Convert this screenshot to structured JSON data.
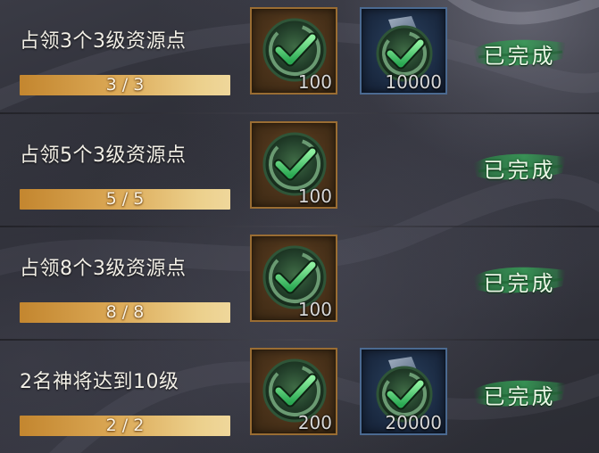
{
  "quests": [
    {
      "title": "占领3个3级资源点",
      "progress_text": "3 / 3",
      "progress_fraction": 1.0,
      "rewards": [
        {
          "type": "bronze",
          "icon": "check-emblem-icon",
          "quantity": "100"
        },
        {
          "type": "blue",
          "icon": "check-emblem-icon",
          "quantity": "10000"
        }
      ],
      "status": "已完成"
    },
    {
      "title": "占领5个3级资源点",
      "progress_text": "5 / 5",
      "progress_fraction": 1.0,
      "rewards": [
        {
          "type": "bronze",
          "icon": "check-emblem-icon",
          "quantity": "100"
        }
      ],
      "status": "已完成"
    },
    {
      "title": "占领8个3级资源点",
      "progress_text": "8 / 8",
      "progress_fraction": 1.0,
      "rewards": [
        {
          "type": "bronze",
          "icon": "check-emblem-icon",
          "quantity": "100"
        }
      ],
      "status": "已完成"
    },
    {
      "title": "2名神将达到10级",
      "progress_text": "2 / 2",
      "progress_fraction": 1.0,
      "rewards": [
        {
          "type": "bronze",
          "icon": "check-emblem-icon",
          "quantity": "200"
        },
        {
          "type": "blue",
          "icon": "check-emblem-icon",
          "quantity": "20000"
        }
      ],
      "status": "已完成"
    }
  ],
  "colors": {
    "progress_fill": "#dba855",
    "status_green": "#2e8a4a",
    "bronze_frame": "#9a6d33",
    "blue_frame": "#4b6a91"
  }
}
